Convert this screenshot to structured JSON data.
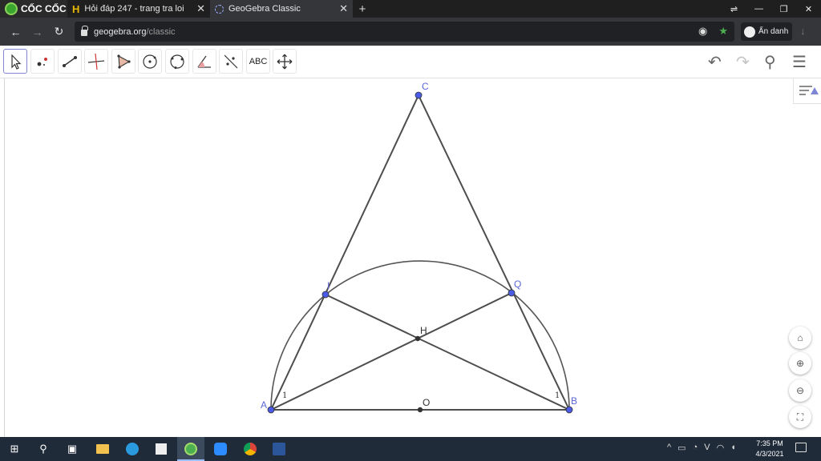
{
  "browser": {
    "brand": "CỐC CỐC",
    "tabs": [
      {
        "title": "Hỏi đáp 247 - trang tra loi",
        "icon": "hoidap-icon"
      },
      {
        "title": "GeoGebra Classic",
        "icon": "geogebra-icon"
      }
    ],
    "url": {
      "domain": "geogebra.org",
      "path": "/classic"
    },
    "incognito_label": "Ẩn danh"
  },
  "toolbar": {
    "tools": [
      "move-tool",
      "point-tool",
      "segment-tool",
      "perpendicular-line-tool",
      "polygon-tool",
      "circle-center-tool",
      "circle-three-points-tool",
      "angle-tool",
      "reflect-tool",
      "text-tool",
      "move-graphics-tool"
    ],
    "text_tool_label": "ABC",
    "selected": "move-tool"
  },
  "construction": {
    "points": [
      {
        "name": "C",
        "label": "C"
      },
      {
        "name": "I",
        "label": "I"
      },
      {
        "name": "Q",
        "label": "Q"
      },
      {
        "name": "H",
        "label": "H"
      },
      {
        "name": "A",
        "label": "A"
      },
      {
        "name": "B",
        "label": "B"
      },
      {
        "name": "O",
        "label": "O"
      }
    ],
    "angle_label_a": "1",
    "angle_label_b": "1",
    "colors": {
      "free_point": "#4a5be6",
      "dependent_point": "#333333",
      "line": "#4d4d4d",
      "label": "#5a66d6"
    }
  },
  "taskbar": {
    "time": "7:35 PM",
    "date": "4/3/2021"
  }
}
